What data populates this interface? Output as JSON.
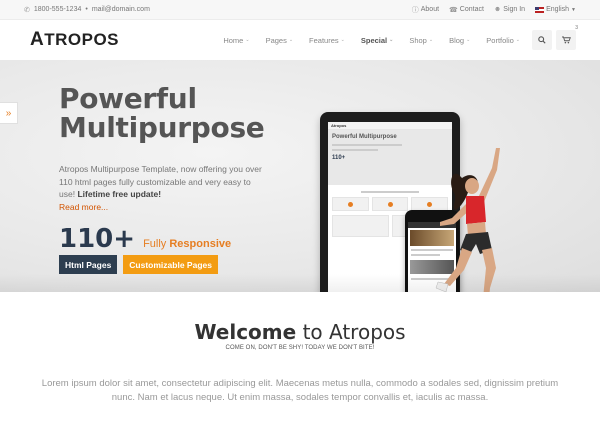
{
  "topbar": {
    "phone": "1800-555-1234",
    "separator": "•",
    "email": "mail@domain.com",
    "links": [
      "About",
      "Contact",
      "Sign In"
    ],
    "language": "English"
  },
  "header": {
    "logo": "TROPOS",
    "logo_mark": "A",
    "nav": [
      {
        "label": "Home",
        "bold": false
      },
      {
        "label": "Pages",
        "bold": false
      },
      {
        "label": "Features",
        "bold": false
      },
      {
        "label": "Special",
        "bold": true
      },
      {
        "label": "Shop",
        "bold": false
      },
      {
        "label": "Blog",
        "bold": false
      },
      {
        "label": "Portfolio",
        "bold": false
      }
    ],
    "cart_count": "3"
  },
  "hero": {
    "side_tab_icon": "»",
    "title_line1": "Powerful",
    "title_line2": "Multipurpose",
    "desc": "Atropos Multipurpose Template, now offering you over 110 html pages fully customizable and very easy to use!",
    "desc_bold": "Lifetime free update!",
    "read_more": "Read more...",
    "count": "110+",
    "count_sub_prefix": "Fully",
    "count_sub_bold": "Responsive",
    "tag1": "Html Pages",
    "tag2": "Customizable Pages",
    "tablet": {
      "brand": "Atropos",
      "title": "Powerful Multipurpose",
      "count": "110+"
    }
  },
  "welcome": {
    "title_bold": "Welcome",
    "title_rest": " to Atropos",
    "subtitle": "COME ON, DON'T BE SHY! TODAY WE DON'T BITE!",
    "body": "Lorem ipsum dolor sit amet, consectetur adipiscing elit. Maecenas metus nulla, commodo a sodales sed, dignissim pretium nunc. Nam et lacus neque. Ut enim massa, sodales tempor convallis et, iaculis ac massa."
  },
  "colors": {
    "accent": "#e67e22",
    "dark_tag": "#2d3e50",
    "orange_tag": "#f39c12"
  }
}
